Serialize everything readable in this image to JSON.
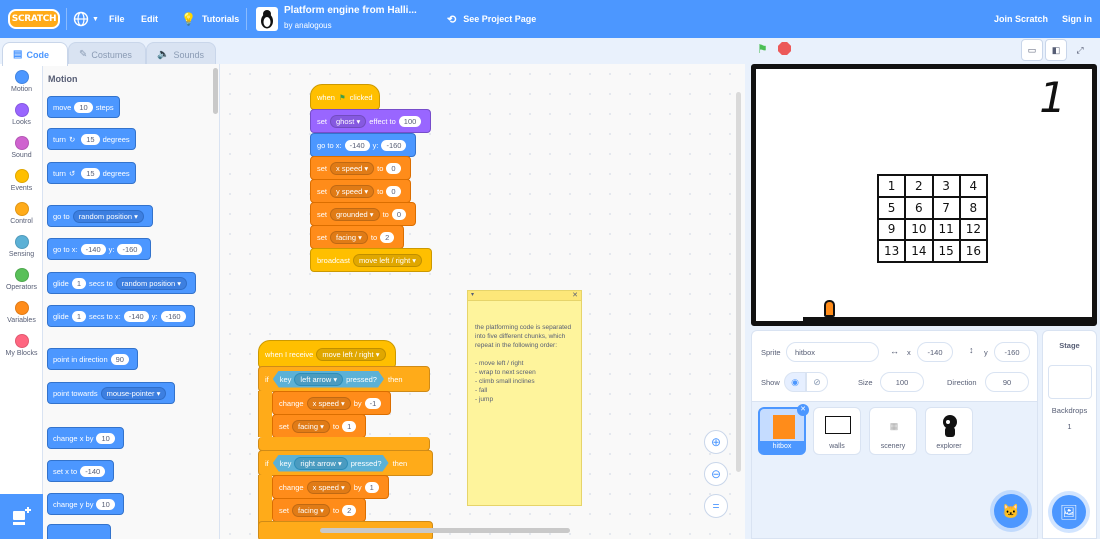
{
  "menu": {
    "logo": "SCRATCH",
    "file": "File",
    "edit": "Edit",
    "tutorials": "Tutorials",
    "project_title": "Platform engine from Halli...",
    "project_author": "by analogous",
    "see_project": "See Project Page",
    "join": "Join Scratch",
    "sign_in": "Sign in",
    "accent": "#4c97ff"
  },
  "tabs": {
    "code": "Code",
    "costumes": "Costumes",
    "sounds": "Sounds"
  },
  "categories": [
    {
      "label": "Motion",
      "color": "#4c97ff"
    },
    {
      "label": "Looks",
      "color": "#9966ff"
    },
    {
      "label": "Sound",
      "color": "#cf63cf"
    },
    {
      "label": "Events",
      "color": "#ffbf00"
    },
    {
      "label": "Control",
      "color": "#ffab19"
    },
    {
      "label": "Sensing",
      "color": "#5cb1d6"
    },
    {
      "label": "Operators",
      "color": "#59c059"
    },
    {
      "label": "Variables",
      "color": "#ff8c1a"
    },
    {
      "label": "My Blocks",
      "color": "#ff6680"
    }
  ],
  "palette": {
    "title": "Motion",
    "move": {
      "a": "move",
      "v": "10",
      "b": "steps"
    },
    "turn_right": {
      "a": "turn",
      "v": "15",
      "b": "degrees"
    },
    "turn_left": {
      "a": "turn",
      "v": "15",
      "b": "degrees"
    },
    "goto": {
      "a": "go to",
      "dd": "random position"
    },
    "goto_xy": {
      "a": "go to x:",
      "x": "-140",
      "b": "y:",
      "y": "-160"
    },
    "glide_to": {
      "a": "glide",
      "v": "1",
      "b": "secs to",
      "dd": "random position"
    },
    "glide_xy": {
      "a": "glide",
      "v": "1",
      "b": "secs to x:",
      "x": "-140",
      "c": "y:",
      "y": "-160"
    },
    "point_dir": {
      "a": "point in direction",
      "v": "90"
    },
    "point_towards": {
      "a": "point towards",
      "dd": "mouse-pointer"
    },
    "change_x": {
      "a": "change x by",
      "v": "10"
    },
    "set_x": {
      "a": "set x to",
      "v": "-140"
    },
    "change_y": {
      "a": "change y by",
      "v": "10"
    }
  },
  "scripts": {
    "flag_hat": {
      "a": "when",
      "b": "clicked"
    },
    "set_effect": {
      "a": "set",
      "dd": "ghost",
      "b": "effect to",
      "v": "100"
    },
    "goto_xy": {
      "a": "go to x:",
      "x": "-140",
      "b": "y:",
      "y": "-160"
    },
    "set_xspeed": {
      "a": "set",
      "dd": "x speed",
      "b": "to",
      "v": "0"
    },
    "set_yspeed": {
      "a": "set",
      "dd": "y speed",
      "b": "to",
      "v": "0"
    },
    "set_grounded": {
      "a": "set",
      "dd": "grounded",
      "b": "to",
      "v": "0"
    },
    "set_facing": {
      "a": "set",
      "dd": "facing",
      "b": "to",
      "v": "2"
    },
    "broadcast": {
      "a": "broadcast",
      "dd": "move left / right"
    },
    "receive_hat": {
      "a": "when I receive",
      "dd": "move left / right"
    },
    "if1": {
      "a": "if",
      "key": "left arrow",
      "b": "pressed?",
      "c": "then"
    },
    "change_xspeed": {
      "a": "change",
      "dd": "x speed",
      "b": "by",
      "v": "-1"
    },
    "set_facing1": {
      "a": "set",
      "dd": "facing",
      "b": "to",
      "v": "1"
    },
    "if2": {
      "a": "if",
      "key": "right arrow",
      "b": "pressed?",
      "c": "then"
    },
    "change_xspeed2": {
      "a": "change",
      "dd": "x speed",
      "b": "by",
      "v": "1"
    },
    "set_facing2": {
      "a": "set",
      "dd": "facing",
      "b": "to",
      "v": "2"
    },
    "key_label": "key"
  },
  "note": {
    "text": "the platforming code is separated into five different chunks, which repeat in the following order:\n\n- move left / right\n- wrap to next screen\n- climb small inclines\n- fall\n- jump"
  },
  "stage": {
    "level": "1",
    "grid": [
      "1",
      "2",
      "3",
      "4",
      "5",
      "6",
      "7",
      "8",
      "9",
      "10",
      "11",
      "12",
      "13",
      "14",
      "15",
      "16"
    ]
  },
  "sprite_info": {
    "sprite_label": "Sprite",
    "sprite_name": "hitbox",
    "x_label": "x",
    "x": "-140",
    "y_label": "y",
    "y": "-160",
    "show_label": "Show",
    "size_label": "Size",
    "size": "100",
    "direction_label": "Direction",
    "direction": "90"
  },
  "sprites": [
    {
      "name": "hitbox",
      "selected": true
    },
    {
      "name": "walls",
      "selected": false
    },
    {
      "name": "scenery",
      "selected": false
    },
    {
      "name": "explorer",
      "selected": false
    }
  ],
  "stage_pane": {
    "title": "Stage",
    "backdrops_label": "Backdrops",
    "backdrops_count": "1"
  }
}
